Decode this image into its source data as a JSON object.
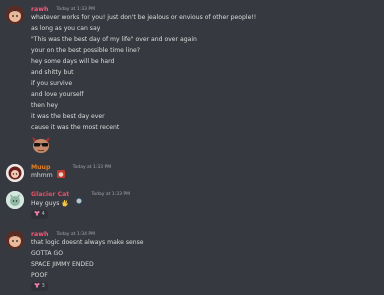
{
  "messages": [
    {
      "username": "rawh",
      "username_color": "#f05a7e",
      "timestamp": "Today at 1:33 PM",
      "lines": [
        "whatever works for you! just don't be jealous or envious of other people!!",
        "as long as you can say",
        "\"This was the best day of my life\" over and over again",
        "your on the best possible time line?",
        "hey some days will be hard",
        "and shitty but",
        "if you survive",
        "and love yourself",
        "then hey",
        "it was the best day ever",
        "cause it was the most recent"
      ]
    },
    {
      "username": "Muup",
      "username_color": "#e67e22",
      "timestamp": "Today at 1:33 PM",
      "lines": [
        "mhmm"
      ]
    },
    {
      "username": "Glacier Cat",
      "username_color": "#e0526a",
      "timestamp": "Today at 1:33 PM",
      "lines": [
        "Hey guys"
      ],
      "reaction_count": "4"
    },
    {
      "username": "rawh",
      "username_color": "#f05a7e",
      "timestamp": "Today at 1:34 PM",
      "lines": [
        "that logic doesnt always make sense",
        "GOTTA GO",
        "SPACE JIMMY ENDED",
        "POOF"
      ],
      "reaction_count": "3"
    }
  ],
  "icons": {
    "custom_emoji": "sunglasses-character-emoji",
    "wave": "waving-hand-emoji",
    "reaction": "blossom-emoji"
  }
}
